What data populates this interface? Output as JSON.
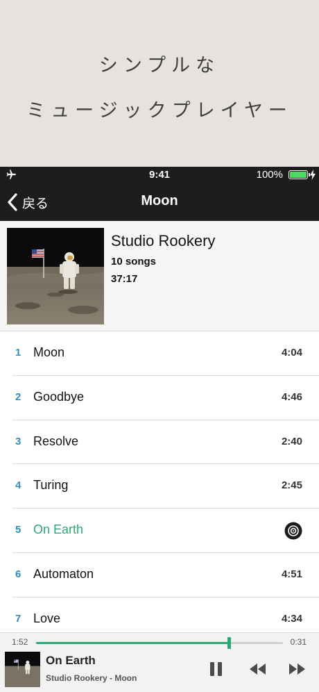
{
  "promo": {
    "line1": "シンプルな",
    "line2": "ミュージックプレイヤー"
  },
  "status_bar": {
    "time": "9:41",
    "battery_percent": "100%",
    "airplane_icon": "airplane-icon",
    "battery_icon": "battery-icon",
    "charging_icon": "bolt-icon"
  },
  "nav": {
    "back_label": "戻る",
    "title": "Moon"
  },
  "album": {
    "title": "Studio Rookery",
    "song_count": "10 songs",
    "total_duration": "37:17"
  },
  "tracks": [
    {
      "number": "1",
      "title": "Moon",
      "duration": "4:04"
    },
    {
      "number": "2",
      "title": "Goodbye",
      "duration": "4:46"
    },
    {
      "number": "3",
      "title": "Resolve",
      "duration": "2:40"
    },
    {
      "number": "4",
      "title": "Turing",
      "duration": "2:45"
    },
    {
      "number": "5",
      "title": "On Earth",
      "duration": "",
      "now_playing_icon": "speaker-icon"
    },
    {
      "number": "6",
      "title": "Automaton",
      "duration": "4:51"
    },
    {
      "number": "7",
      "title": "Love",
      "duration": "4:34"
    }
  ],
  "player": {
    "elapsed": "1:52",
    "remaining": "0:31",
    "progress": 0.78,
    "title": "On Earth",
    "subtitle": "Studio Rookery - Moon",
    "pause_icon": "pause-icon",
    "previous_icon": "rewind-icon",
    "next_icon": "fast-forward-icon"
  },
  "colors": {
    "accent": "#2aa876",
    "track_number": "#2f8fb4",
    "bar_background": "#1d1d1f",
    "battery": "#4cd964"
  }
}
